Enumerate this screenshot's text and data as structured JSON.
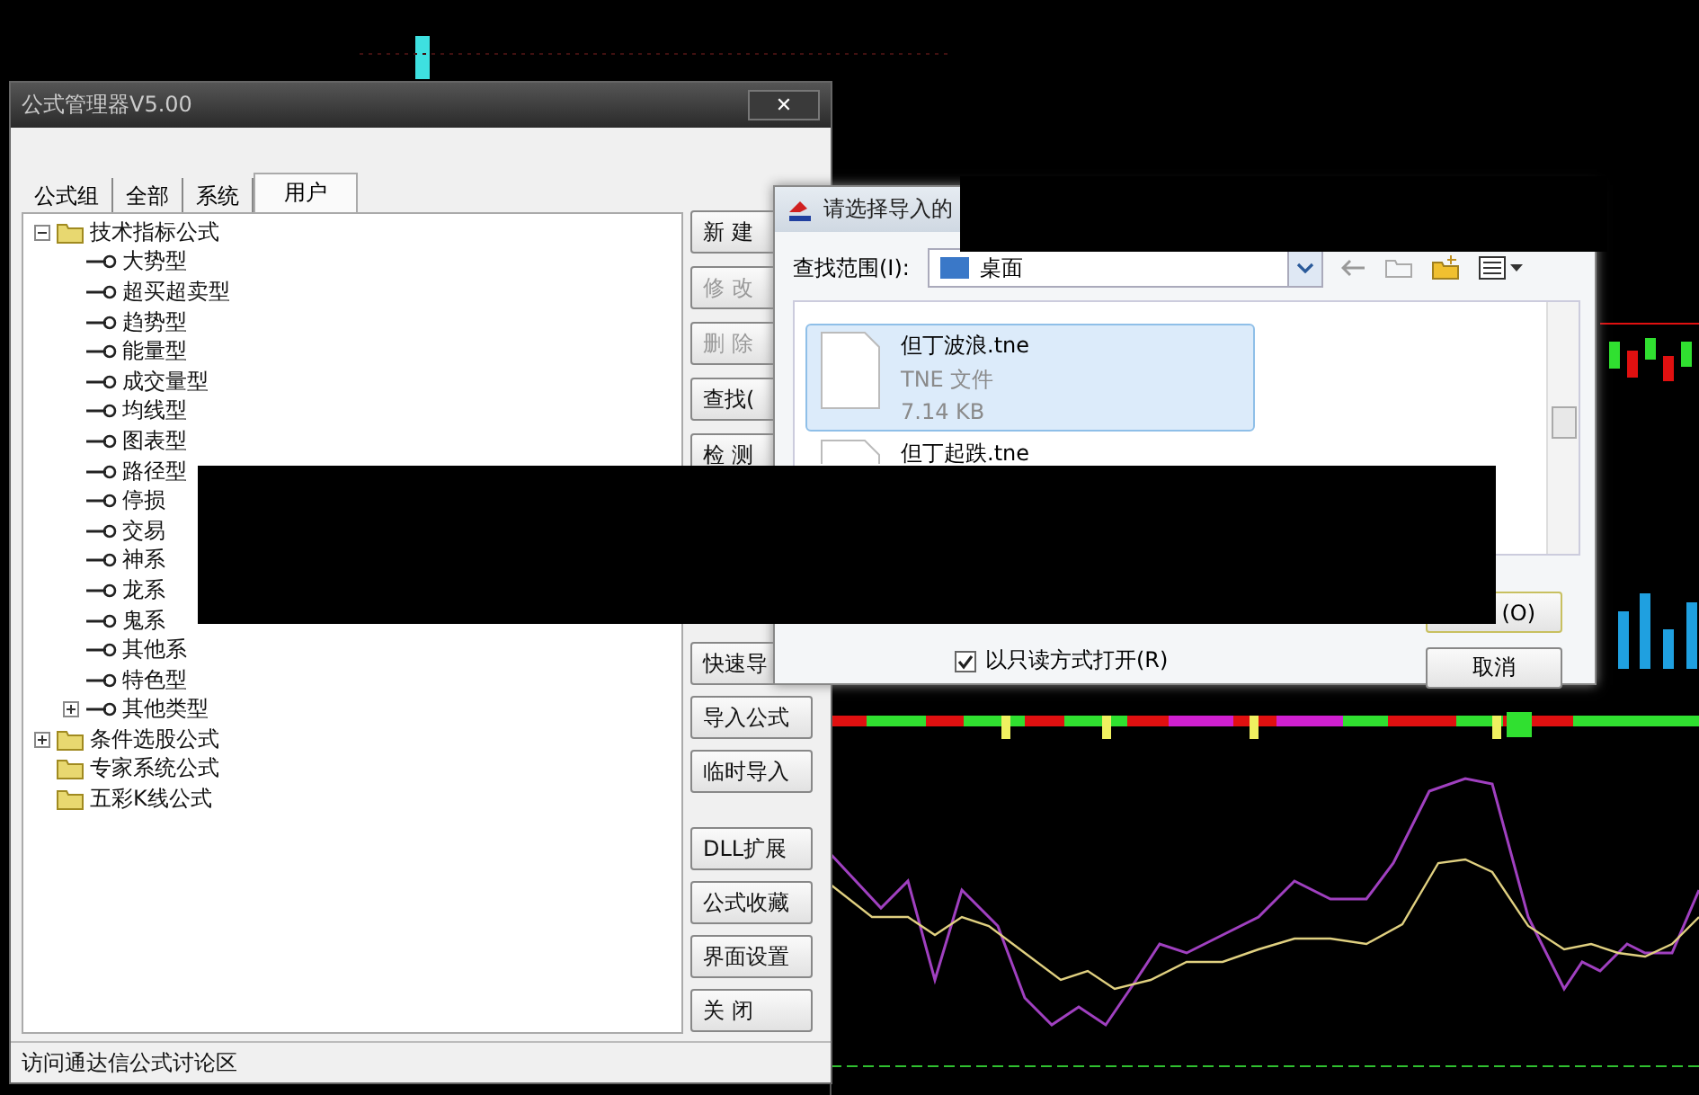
{
  "formula_manager": {
    "title": "公式管理器V5.00",
    "close": "✕",
    "tabs": [
      {
        "label": "公式组",
        "selected": false
      },
      {
        "label": "全部",
        "selected": false
      },
      {
        "label": "系统",
        "selected": false
      },
      {
        "label": "用户",
        "selected": true
      }
    ],
    "tree": [
      {
        "label": "技术指标公式",
        "kind": "folder",
        "expanded": true,
        "children": [
          {
            "label": "大势型",
            "kind": "formula"
          },
          {
            "label": "超买超卖型",
            "kind": "formula"
          },
          {
            "label": "趋势型",
            "kind": "formula"
          },
          {
            "label": "能量型",
            "kind": "formula"
          },
          {
            "label": "成交量型",
            "kind": "formula"
          },
          {
            "label": "均线型",
            "kind": "formula"
          },
          {
            "label": "图表型",
            "kind": "formula"
          },
          {
            "label": "路径型",
            "kind": "formula"
          },
          {
            "label": "停损",
            "kind": "formula"
          },
          {
            "label": "交易",
            "kind": "formula"
          },
          {
            "label": "神系",
            "kind": "formula"
          },
          {
            "label": "龙系",
            "kind": "formula"
          },
          {
            "label": "鬼系",
            "kind": "formula"
          },
          {
            "label": "其他系",
            "kind": "formula"
          },
          {
            "label": "特色型",
            "kind": "formula"
          },
          {
            "label": "其他类型",
            "kind": "formula",
            "expanded": false
          }
        ]
      },
      {
        "label": "条件选股公式",
        "kind": "folder",
        "expanded": false
      },
      {
        "label": "专家系统公式",
        "kind": "folder"
      },
      {
        "label": "五彩K线公式",
        "kind": "folder"
      }
    ],
    "button_groups": [
      [
        {
          "label": "新 建",
          "disabled": false
        },
        {
          "label": "修 改",
          "disabled": true
        },
        {
          "label": "删 除",
          "disabled": true
        },
        {
          "label": "查找(",
          "disabled": false
        },
        {
          "label": "检 测",
          "disabled": false
        }
      ],
      [
        {
          "label": "快速导",
          "disabled": false
        },
        {
          "label": "导入公式",
          "disabled": false
        },
        {
          "label": "临时导入",
          "disabled": false
        }
      ],
      [
        {
          "label": "DLL扩展",
          "disabled": false
        },
        {
          "label": "公式收藏",
          "disabled": false
        },
        {
          "label": "界面设置",
          "disabled": false
        },
        {
          "label": "关 闭",
          "disabled": false
        }
      ]
    ],
    "status_bar": "访问通达信公式讨论区"
  },
  "import_dialog": {
    "title": "请选择导入的",
    "look_in_label": "查找范围(I):",
    "look_in_value": "桌面",
    "files": [
      {
        "name": "但丁波浪.tne",
        "type": "TNE 文件",
        "size": "7.14 KB",
        "selected": true
      },
      {
        "name": "但丁起跌.tne",
        "selected": false
      }
    ],
    "open_button": "(O)",
    "cancel_button": "取消",
    "readonly": {
      "label": "以只读方式打开(R)",
      "checked": true
    }
  }
}
